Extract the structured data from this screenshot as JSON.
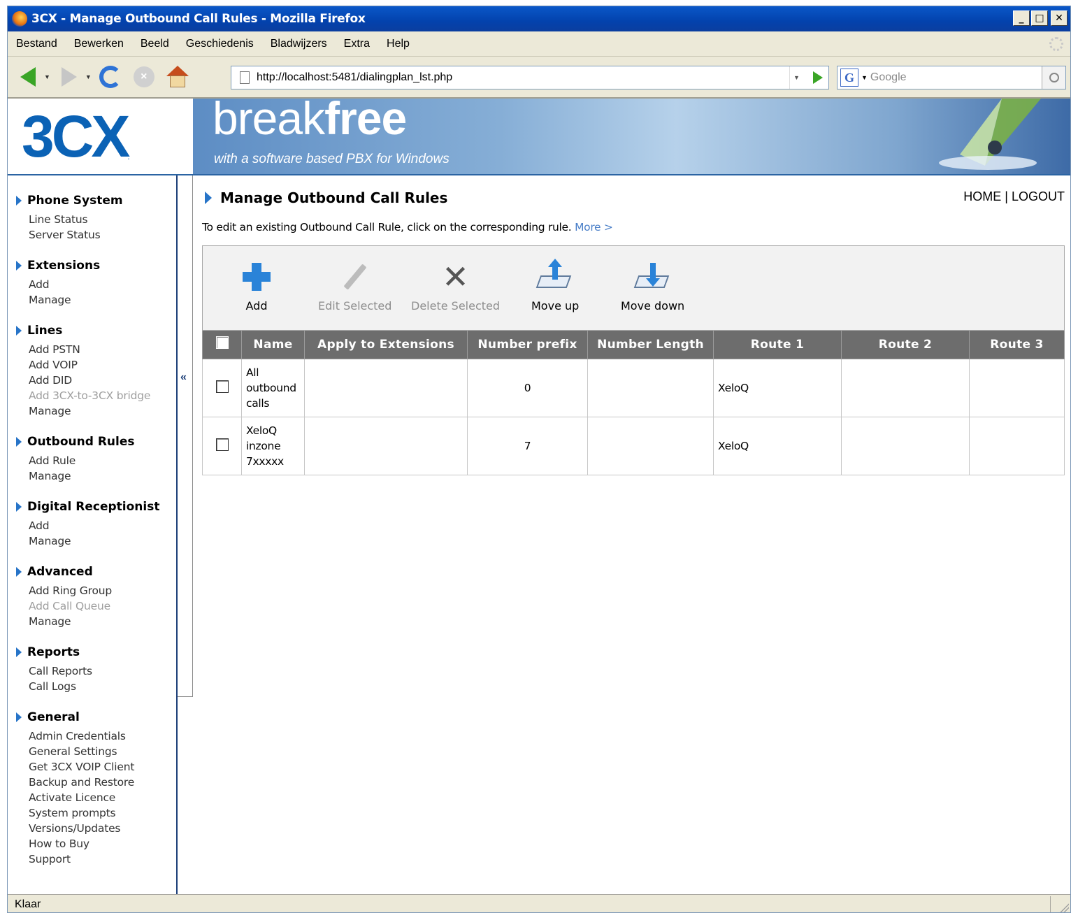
{
  "window": {
    "title": "3CX - Manage Outbound Call Rules - Mozilla Firefox",
    "controls": {
      "minimize": "_",
      "maximize": "□",
      "close": "✕"
    }
  },
  "menu": [
    "Bestand",
    "Bewerken",
    "Beeld",
    "Geschiedenis",
    "Bladwijzers",
    "Extra",
    "Help"
  ],
  "nav": {
    "url": "http://localhost:5481/dialingplan_lst.php",
    "search_placeholder": "Google",
    "search_engine_glyph": "G"
  },
  "banner": {
    "logo": "3CX",
    "logo_mark": ".",
    "headline_light": "break",
    "headline_bold": "free",
    "tagline": "with a software based PBX for Windows"
  },
  "sidebar": [
    {
      "title": "Phone System",
      "links": [
        {
          "label": "Line Status",
          "dim": false
        },
        {
          "label": "Server Status",
          "dim": false
        }
      ]
    },
    {
      "title": "Extensions",
      "links": [
        {
          "label": "Add",
          "dim": false
        },
        {
          "label": "Manage",
          "dim": false
        }
      ]
    },
    {
      "title": "Lines",
      "links": [
        {
          "label": "Add PSTN",
          "dim": false
        },
        {
          "label": "Add VOIP",
          "dim": false
        },
        {
          "label": "Add DID",
          "dim": false
        },
        {
          "label": "Add 3CX-to-3CX bridge",
          "dim": true
        },
        {
          "label": "Manage",
          "dim": false
        }
      ]
    },
    {
      "title": "Outbound Rules",
      "links": [
        {
          "label": "Add Rule",
          "dim": false
        },
        {
          "label": "Manage",
          "dim": false
        }
      ]
    },
    {
      "title": "Digital Receptionist",
      "links": [
        {
          "label": "Add",
          "dim": false
        },
        {
          "label": "Manage",
          "dim": false
        }
      ]
    },
    {
      "title": "Advanced",
      "links": [
        {
          "label": "Add Ring Group",
          "dim": false
        },
        {
          "label": "Add Call Queue",
          "dim": true
        },
        {
          "label": "Manage",
          "dim": false
        }
      ]
    },
    {
      "title": "Reports",
      "links": [
        {
          "label": "Call Reports",
          "dim": false
        },
        {
          "label": "Call Logs",
          "dim": false
        }
      ]
    },
    {
      "title": "General",
      "links": [
        {
          "label": "Admin Credentials",
          "dim": false
        },
        {
          "label": "General Settings",
          "dim": false
        },
        {
          "label": "Get 3CX VOIP Client",
          "dim": false
        },
        {
          "label": "Backup and Restore",
          "dim": false
        },
        {
          "label": "Activate Licence",
          "dim": false
        },
        {
          "label": "System prompts",
          "dim": false
        },
        {
          "label": "Versions/Updates",
          "dim": false
        },
        {
          "label": "How to Buy",
          "dim": false
        },
        {
          "label": "Support",
          "dim": false
        }
      ]
    }
  ],
  "collapse_glyph": "«",
  "page": {
    "title": "Manage Outbound Call Rules",
    "home": "HOME",
    "separator": "|",
    "logout": "LOGOUT",
    "intro": "To edit an existing Outbound Call Rule, click on the corresponding rule.",
    "more": "More >"
  },
  "toolbar": {
    "add": "Add",
    "edit": "Edit Selected",
    "delete": "Delete Selected",
    "move_up": "Move up",
    "move_down": "Move down"
  },
  "table": {
    "headers": [
      "Name",
      "Apply to Extensions",
      "Number prefix",
      "Number Length",
      "Route 1",
      "Route 2",
      "Route 3"
    ],
    "rows": [
      {
        "name_lines": [
          "All",
          "outbound",
          "calls"
        ],
        "apply": "",
        "prefix": "0",
        "length": "",
        "route1": "XeloQ",
        "route2": "",
        "route3": ""
      },
      {
        "name_lines": [
          "XeloQ",
          "inzone",
          "7xxxxx"
        ],
        "apply": "",
        "prefix": "7",
        "length": "",
        "route1": "XeloQ",
        "route2": "",
        "route3": ""
      }
    ]
  },
  "status": "Klaar"
}
